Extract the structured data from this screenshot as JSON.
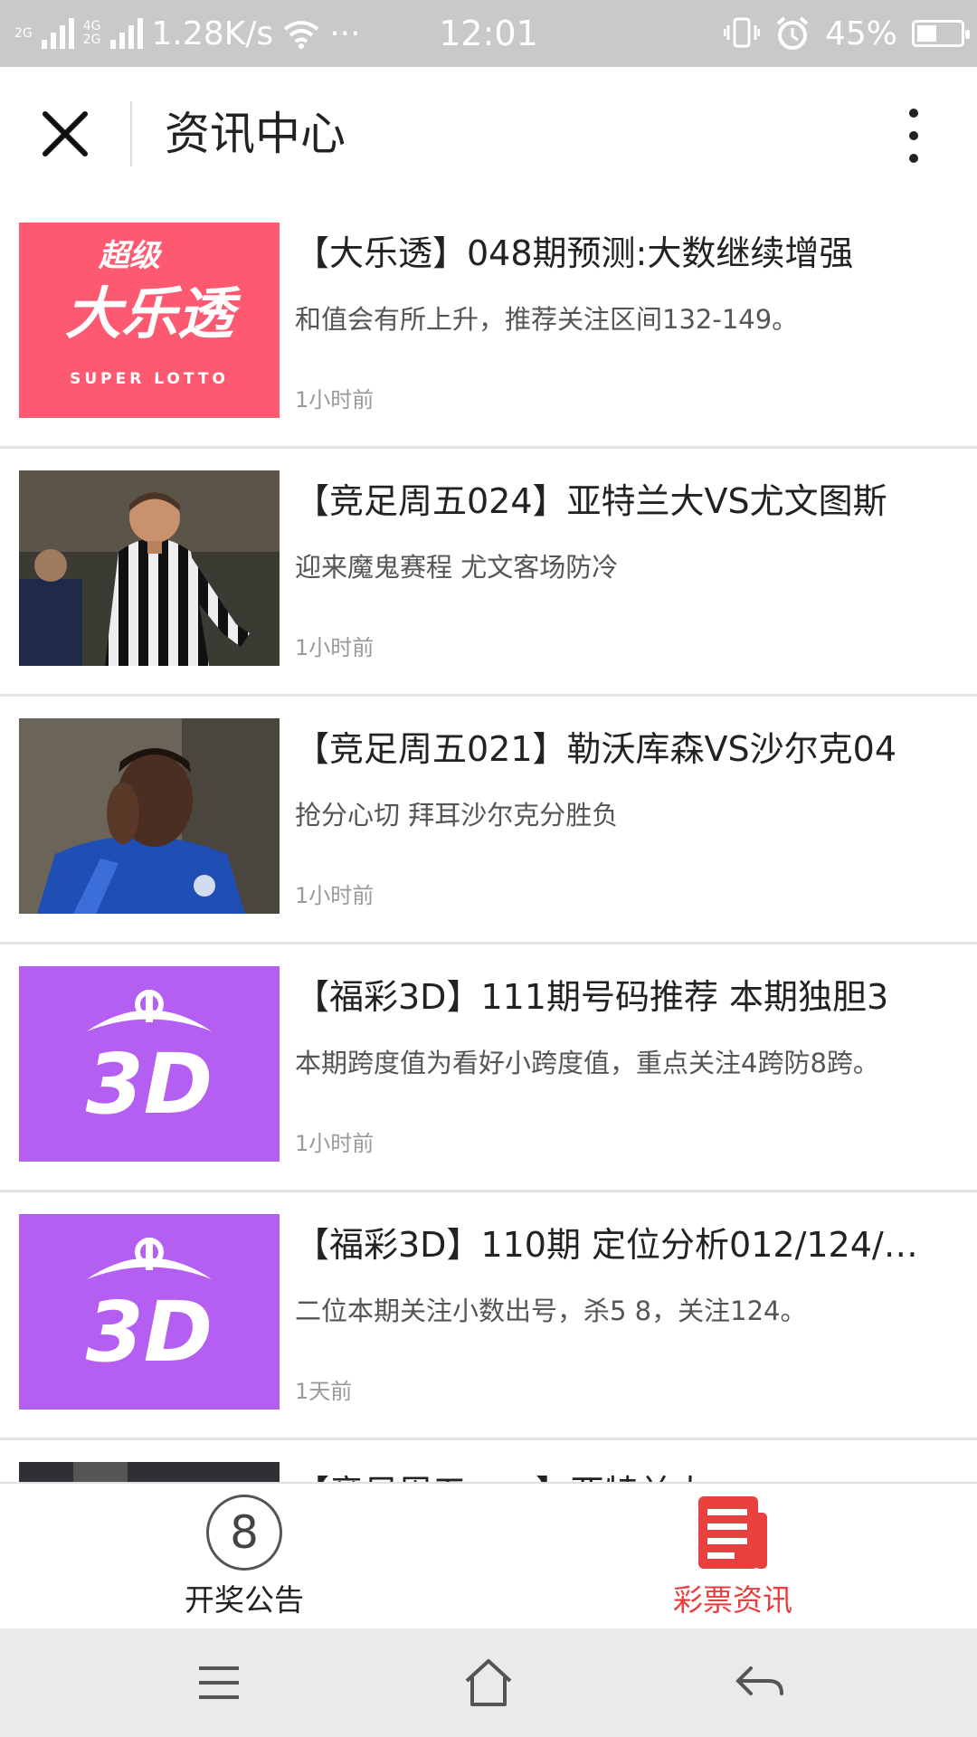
{
  "status_bar": {
    "net_type_top": "2G",
    "net_type_mid": "4G",
    "net_type_bot": "2G",
    "speed": "1.28K/s",
    "more": "···",
    "time": "12:01",
    "battery": "45%",
    "battery_level": 0.45
  },
  "header": {
    "title": "资讯中心",
    "close_icon": "close-icon",
    "more_icon": "more-vertical-icon"
  },
  "articles": [
    {
      "title": "【大乐透】048期预测:大数继续增强",
      "summary": "和值会有所上升，推荐关注区间132-149。",
      "time": "1小时前",
      "thumb": "super-lotto-logo"
    },
    {
      "title": "【竞足周五024】亚特兰大VS尤文图斯",
      "summary": "迎来魔鬼赛程 尤文客场防冷",
      "time": "1小时前",
      "thumb": "photo-juventus-player"
    },
    {
      "title": "【竞足周五021】勒沃库森VS沙尔克04",
      "summary": "抢分心切 拜耳沙尔克分胜负",
      "time": "1小时前",
      "thumb": "photo-schalke-player"
    },
    {
      "title": "【福彩3D】111期号码推荐 本期独胆3",
      "summary": "本期跨度值为看好小跨度值，重点关注4跨防8跨。",
      "time": "1小时前",
      "thumb": "fucai-3d-logo"
    },
    {
      "title": "【福彩3D】110期 定位分析012/124/…",
      "summary": "二位本期关注小数出号，杀5 8，关注124。",
      "time": "1天前",
      "thumb": "fucai-3d-logo"
    },
    {
      "title": "【竞足周五……】亚特兰大……",
      "summary": "",
      "time": "",
      "thumb": "photo-partial"
    }
  ],
  "logos": {
    "super_lotto_top": "超级",
    "super_lotto_main": "大乐透",
    "super_lotto_en": "SUPER LOTTO",
    "fucai_3d": "3D"
  },
  "tabbar": {
    "tab1_label": "开奖公告",
    "tab1_badge": "8",
    "tab2_label": "彩票资讯",
    "active": "彩票资讯",
    "active_color": "#e8403e"
  },
  "navbar": {
    "menu_icon": "menu-icon",
    "home_icon": "home-icon",
    "back_icon": "back-icon"
  },
  "colors": {
    "lotto_pink": "#fd5a72",
    "fucai_purple": "#b45ff2",
    "statusbar": "#c9c9c9"
  }
}
